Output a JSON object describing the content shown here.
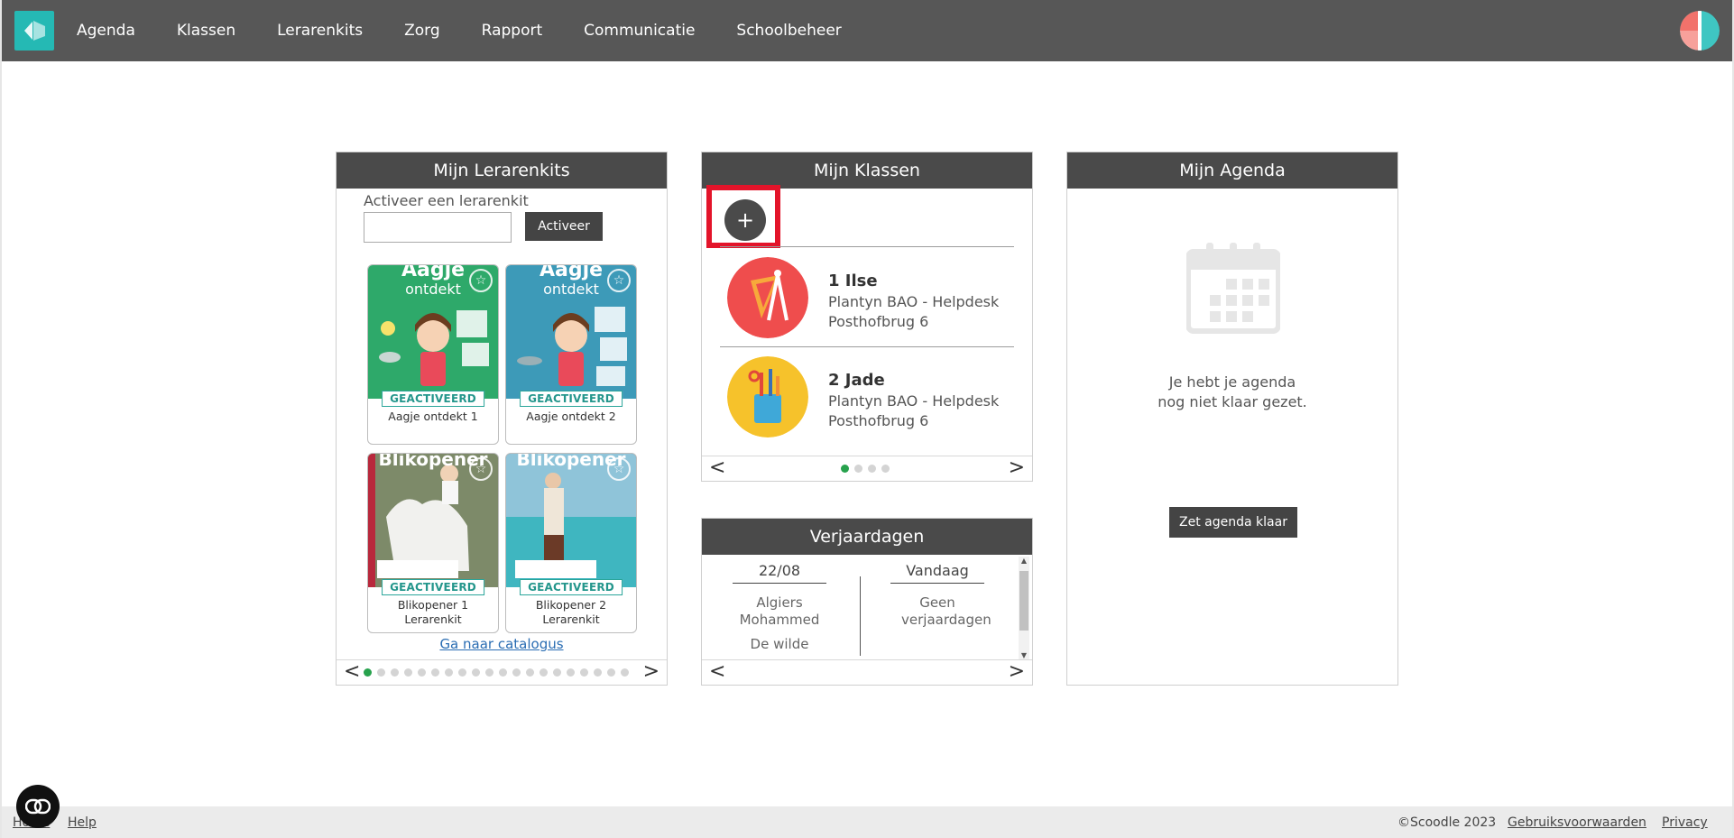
{
  "nav": {
    "items": [
      "Agenda",
      "Klassen",
      "Lerarenkits",
      "Zorg",
      "Rapport",
      "Communicatie",
      "Schoolbeheer"
    ]
  },
  "kits": {
    "title": "Mijn Lerarenkits",
    "activate_label": "Activeer een lerarenkit",
    "activate_placeholder": "",
    "activate_button": "Activeer",
    "cards": [
      {
        "cover_title": "Aagje",
        "cover_sub": "ontdekt",
        "badge": "GEACTIVEERD",
        "name": "Aagje ontdekt 1",
        "color": "#2ea96a"
      },
      {
        "cover_title": "Aagje",
        "cover_sub": "ontdekt",
        "badge": "GEACTIVEERD",
        "name": "Aagje ontdekt 2",
        "color": "#3d9ab8"
      },
      {
        "cover_title": "Blikopener",
        "cover_sub": "",
        "badge": "GEACTIVEERD",
        "name": "Blikopener 1 Lerarenkit",
        "color": "#b8283c"
      },
      {
        "cover_title": "Blikopener",
        "cover_sub": "",
        "badge": "GEACTIVEERD",
        "name": "Blikopener 2 Lerarenkit",
        "color": "#2c7a9e"
      }
    ],
    "catalog_link": "Ga naar catalogus",
    "page_count": 20,
    "active_page": 0
  },
  "klassen": {
    "title": "Mijn Klassen",
    "add_label": "+",
    "classes": [
      {
        "name": "1 Ilse",
        "school": "Plantyn BAO - Helpdesk",
        "address": "Posthofbrug 6",
        "color": "#ef4d4d"
      },
      {
        "name": "2 Jade",
        "school": "Plantyn BAO - Helpdesk",
        "address": "Posthofbrug 6",
        "color": "#f6c22b"
      }
    ],
    "page_count": 4,
    "active_page": 0
  },
  "verjaardagen": {
    "title": "Verjaardagen",
    "columns": [
      {
        "date": "22/08",
        "entries": [
          "Algiers Mohammed",
          "De wilde"
        ]
      },
      {
        "date": "Vandaag",
        "entries": [
          "Geen verjaardagen"
        ]
      }
    ]
  },
  "agenda": {
    "title": "Mijn Agenda",
    "empty_text": "Je hebt je agenda nog niet klaar gezet.",
    "button": "Zet agenda klaar"
  },
  "footer": {
    "home": "Home",
    "help": "Help",
    "copyright": "©Scoodle 2023",
    "terms": "Gebruiksvoorwaarden",
    "privacy": "Privacy"
  },
  "colors": {
    "topbar": "#575757",
    "brand": "#25b9b4",
    "highlight": "#e3142a",
    "active_dot": "#27a24d"
  },
  "icons": [
    "logo-icon",
    "user-avatar",
    "star-icon",
    "plus-icon",
    "calendar-icon",
    "chat-icon",
    "chevron-left-icon",
    "chevron-right-icon"
  ]
}
